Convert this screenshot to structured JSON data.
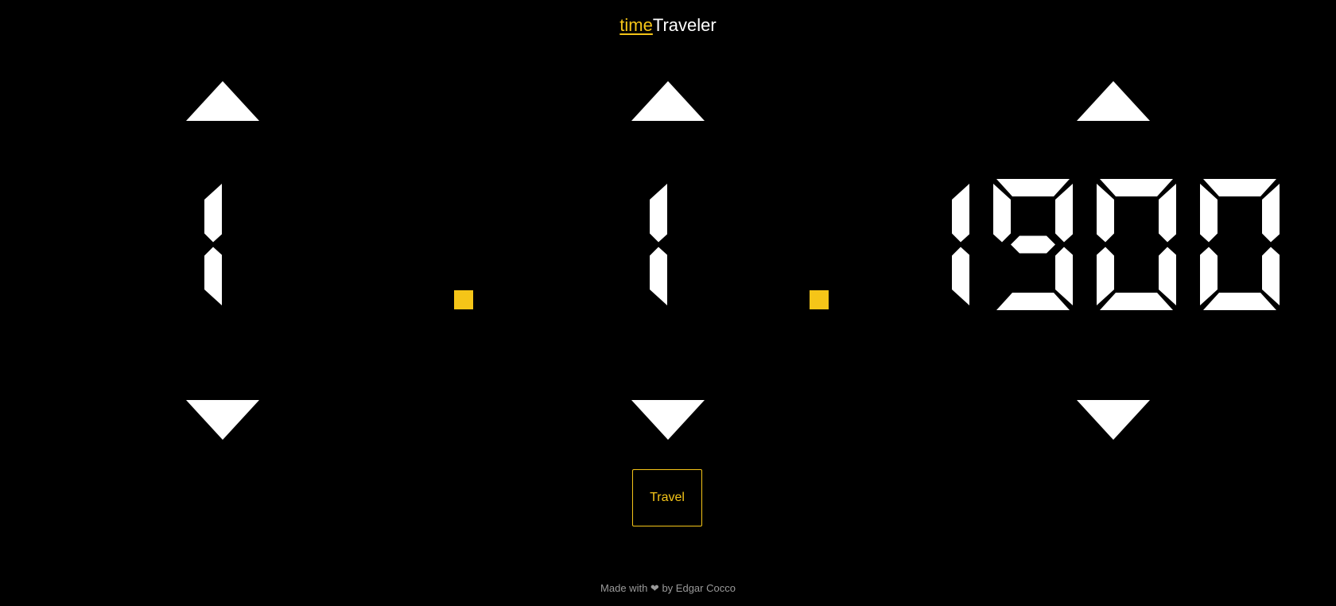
{
  "header": {
    "title_accent": "time",
    "title_rest": "Traveler"
  },
  "date": {
    "day": "1",
    "month": "1",
    "year": "1900"
  },
  "controls": {
    "travel_label": "Travel",
    "up_icon": "triangle-up-icon",
    "down_icon": "triangle-down-icon"
  },
  "footer": {
    "prefix": "Made with",
    "heart_icon": "heart-icon",
    "suffix": "by Edgar Cocco"
  },
  "colors": {
    "background": "#000000",
    "segment": "#ffffff",
    "accent": "#f5c518",
    "footer_text": "#9a9a9a"
  }
}
